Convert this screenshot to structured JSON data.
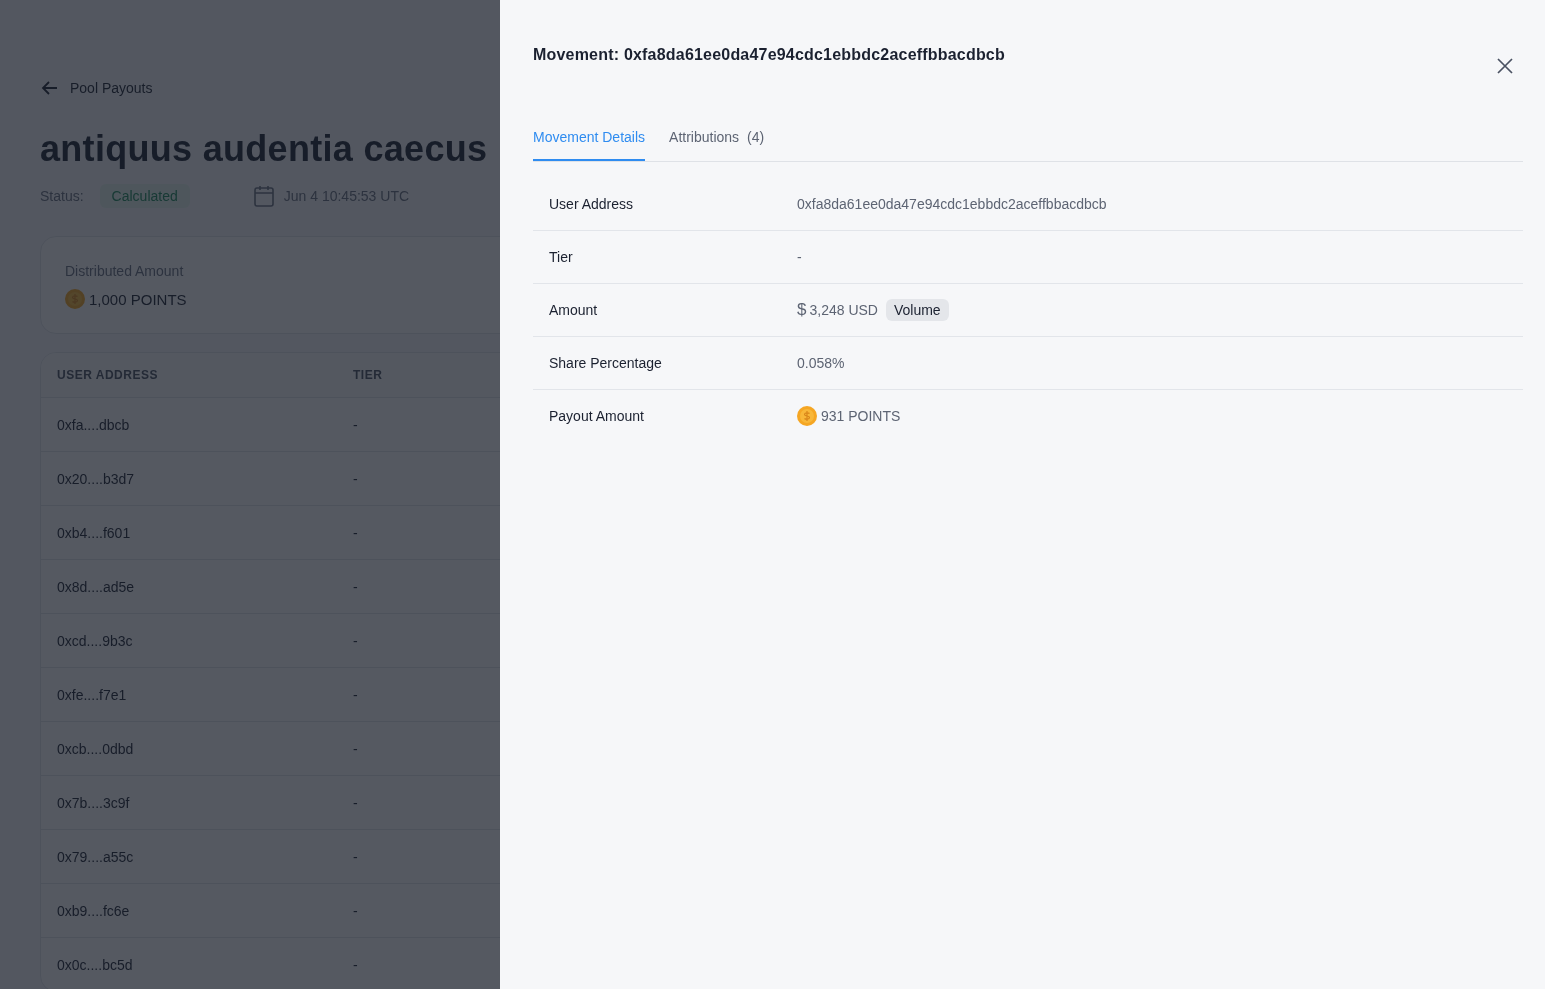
{
  "page": {
    "back_link": "Pool Payouts",
    "title": "antiquus audentia caecus",
    "status_label": "Status:",
    "status": "Calculated",
    "date": "Jun 4 10:45:53 UTC",
    "summary": {
      "label": "Distributed Amount",
      "value": "1,000 POINTS"
    },
    "table": {
      "columns": [
        "USER ADDRESS",
        "TIER"
      ],
      "rows": [
        [
          "0xfa....dbcb",
          "-"
        ],
        [
          "0x20....b3d7",
          "-"
        ],
        [
          "0xb4....f601",
          "-"
        ],
        [
          "0x8d....ad5e",
          "-"
        ],
        [
          "0xcd....9b3c",
          "-"
        ],
        [
          "0xfe....f7e1",
          "-"
        ],
        [
          "0xcb....0dbd",
          "-"
        ],
        [
          "0x7b....3c9f",
          "-"
        ],
        [
          "0x79....a55c",
          "-"
        ],
        [
          "0xb9....fc6e",
          "-"
        ],
        [
          "0x0c....bc5d",
          "-"
        ]
      ]
    }
  },
  "drawer": {
    "title": "Movement: 0xfa8da61ee0da47e94cdc1ebbdc2aceffbbacdbcb",
    "tabs": [
      {
        "label": "Movement Details",
        "selected": true
      },
      {
        "label": "Attributions",
        "count": "(4)",
        "selected": false
      }
    ],
    "details": [
      {
        "kind": "text",
        "label": "User Address",
        "value": "0xfa8da61ee0da47e94cdc1ebbdc2aceffbbacdbcb"
      },
      {
        "kind": "text",
        "label": "Tier",
        "value": "-"
      },
      {
        "kind": "usd",
        "label": "Amount",
        "currency": "$",
        "value": "3,248 USD",
        "tag": "Volume"
      },
      {
        "kind": "text",
        "label": "Share Percentage",
        "value": "0.058%"
      },
      {
        "kind": "points",
        "label": "Payout Amount",
        "value": "931 POINTS"
      }
    ]
  }
}
